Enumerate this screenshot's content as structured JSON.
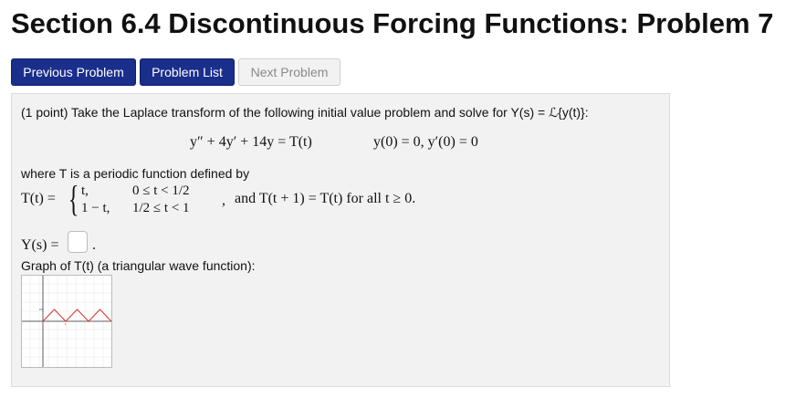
{
  "header": {
    "title": "Section 6.4 Discontinuous Forcing Functions: Problem 7"
  },
  "nav": {
    "previous_label": "Previous Problem",
    "list_label": "Problem List",
    "next_label": "Next Problem"
  },
  "problem": {
    "intro": "(1 point) Take the Laplace transform of the following initial value problem and solve for Y(s) = ℒ{y(t)}:",
    "ode": "y″ + 4y′ + 14y = T(t)",
    "initial_conditions": "y(0) = 0,  y′(0) = 0",
    "where_text": "where T is a periodic function defined by",
    "piecewise_lhs": "T(t) =",
    "piece1_expr": "t,",
    "piece1_cond": "0 ≤ t < 1/2",
    "piece2_expr": "1 − t,",
    "piece2_cond": "1/2 ≤ t < 1",
    "comma": ",",
    "periodicity": "and T(t + 1) = T(t) for all t ≥ 0.",
    "answer_label": "Y(s) =",
    "answer_value": "",
    "answer_period": ".",
    "graph_caption": "Graph of T(t) (a triangular wave function):"
  },
  "graph": {
    "y_tick_label": "0.5",
    "x_tick_label": "1",
    "wave_color": "#e03030",
    "axis_color": "#333333",
    "grid_color": "#e6e6e6"
  }
}
